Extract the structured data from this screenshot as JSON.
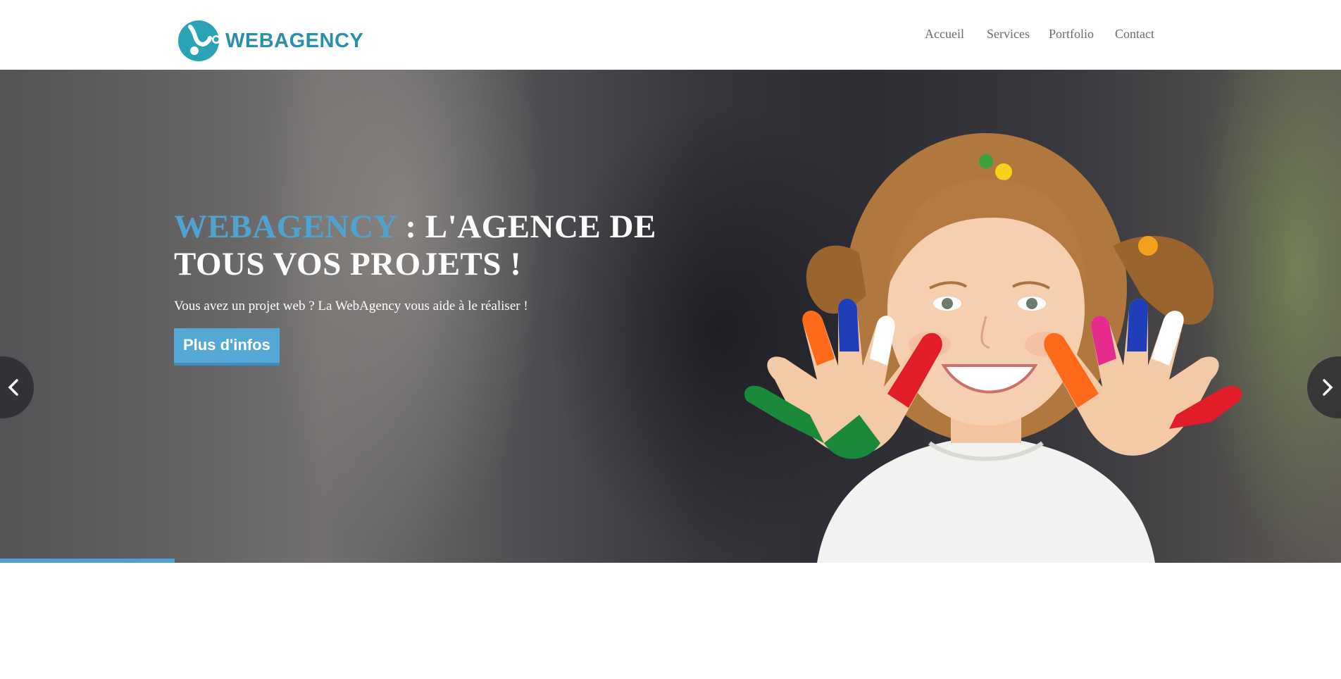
{
  "header": {
    "logo_text": "WEBAGENCY",
    "logo_icon": "webagency-logo-icon",
    "nav": [
      {
        "label": "Accueil"
      },
      {
        "label": "Services"
      },
      {
        "label": "Portfolio"
      },
      {
        "label": "Contact"
      }
    ]
  },
  "hero": {
    "headline_brand": "WEBAGENCY",
    "headline_rest": " : L'AGENCE DE TOUS VOS PROJETS !",
    "subtitle": "Vous avez un projet web ? La WebAgency vous aide à le réaliser !",
    "cta_label": "Plus d'infos",
    "prev_icon": "chevron-left-icon",
    "next_icon": "chevron-right-icon",
    "slide_progress": 0.13
  },
  "colors": {
    "brand": "#2a8fa8",
    "accent": "#4fa3d1",
    "button": "#55a8d6"
  }
}
